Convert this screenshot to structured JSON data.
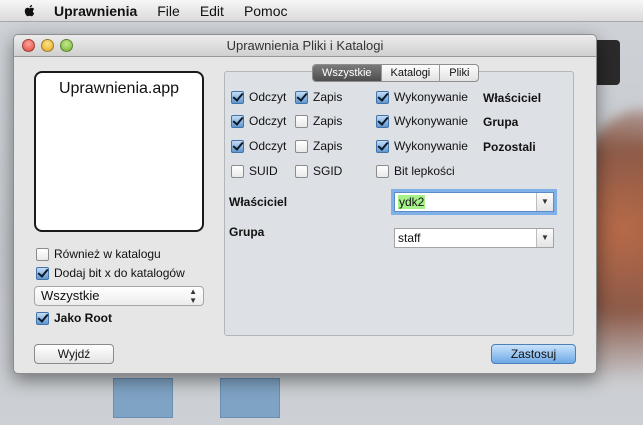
{
  "menubar": {
    "app": "Uprawnienia",
    "items": [
      "File",
      "Edit",
      "Pomoc"
    ]
  },
  "window": {
    "title": "Uprawnienia Pliki i Katalogi"
  },
  "left": {
    "app_name": "Uprawnienia.app",
    "rowniez": {
      "label": "Również w katalogu",
      "checked": false
    },
    "dodaj": {
      "label": "Dodaj bit x do katalogów",
      "checked": true
    },
    "select_value": "Wszystkie",
    "jako_root": {
      "label": "Jako Root",
      "checked": true
    }
  },
  "tabs": [
    "Wszystkie",
    "Katalogi",
    "Pliki"
  ],
  "perm_rows": [
    {
      "read": {
        "label": "Odczyt",
        "checked": true
      },
      "write": {
        "label": "Zapis",
        "checked": true
      },
      "exec": {
        "label": "Wykonywanie",
        "checked": true
      },
      "who": "Właściciel"
    },
    {
      "read": {
        "label": "Odczyt",
        "checked": true
      },
      "write": {
        "label": "Zapis",
        "checked": false
      },
      "exec": {
        "label": "Wykonywanie",
        "checked": true
      },
      "who": "Grupa"
    },
    {
      "read": {
        "label": "Odczyt",
        "checked": true
      },
      "write": {
        "label": "Zapis",
        "checked": false
      },
      "exec": {
        "label": "Wykonywanie",
        "checked": true
      },
      "who": "Pozostali"
    },
    {
      "read": {
        "label": "SUID",
        "checked": false
      },
      "write": {
        "label": "SGID",
        "checked": false
      },
      "exec": {
        "label": "Bit lepkości",
        "checked": false
      },
      "who": ""
    }
  ],
  "owner": {
    "label": "Właściciel",
    "value": "ydk2"
  },
  "group": {
    "label": "Grupa",
    "value": "staff"
  },
  "buttons": {
    "quit": "Wyjdź",
    "apply": "Zastosuj"
  },
  "colors": {
    "accent": "#5f96cf",
    "highlight": "#a6f08a",
    "focus_ring": "#7fb1e8"
  }
}
